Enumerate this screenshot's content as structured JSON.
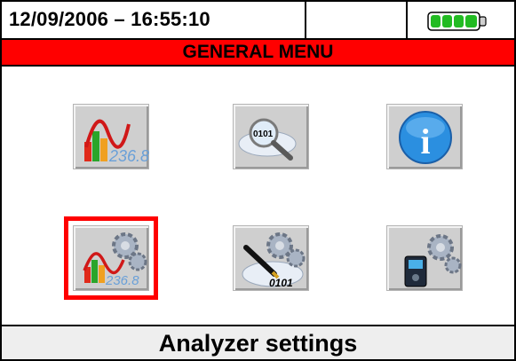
{
  "header": {
    "datetime": "12/09/2006 – 16:55:10",
    "battery_icon": "battery-full-icon",
    "battery_color": "#22bb22"
  },
  "menu": {
    "title": "GENERAL MENU",
    "title_bg": "#ff0000",
    "items": [
      {
        "name": "analyzer-chart-icon"
      },
      {
        "name": "binary-search-icon"
      },
      {
        "name": "info-icon"
      },
      {
        "name": "analyzer-settings-icon",
        "selected": true
      },
      {
        "name": "recording-settings-icon"
      },
      {
        "name": "meter-settings-icon"
      }
    ],
    "item_labels": [
      "236.8",
      "0101",
      "i",
      "236.8",
      "0101"
    ]
  },
  "footer": {
    "status": "Analyzer settings"
  }
}
